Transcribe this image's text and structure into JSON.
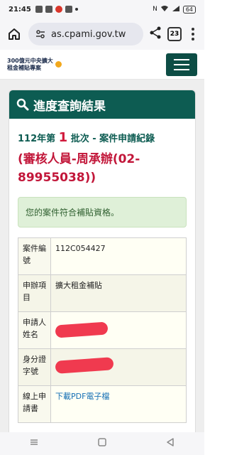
{
  "status_bar": {
    "time": "21:45",
    "battery": "64"
  },
  "browser": {
    "url": "as.cpami.gov.tw",
    "tab_count": "23"
  },
  "site": {
    "logo_line1": "300億元中央擴大",
    "logo_line2": "租金補貼專案"
  },
  "card": {
    "title": "進度查詢結果",
    "record_prefix": "112年第",
    "record_number": "1",
    "record_suffix": "批次 - 案件申請紀錄",
    "officer_line1": "(審核人員-周承辦(02-",
    "officer_line2": "89955038))",
    "notice": "您的案件符合補貼資格。"
  },
  "table": {
    "rows": [
      {
        "label": "案件編號",
        "value": "112C054427"
      },
      {
        "label": "申辦項目",
        "value": "擴大租金補貼"
      },
      {
        "label": "申請人姓名",
        "value": ""
      },
      {
        "label": "身分證字號",
        "value": ""
      },
      {
        "label": "線上申請書",
        "value": "下載PDF電子檔"
      }
    ]
  },
  "colors": {
    "primary": "#0d5c52",
    "accent_red": "#c2173a",
    "notice_bg": "#dff0d8"
  }
}
